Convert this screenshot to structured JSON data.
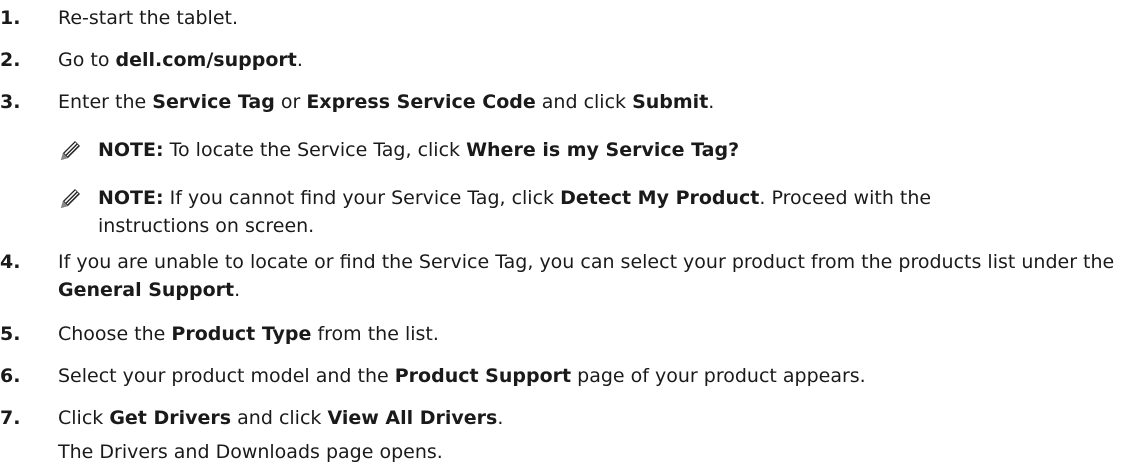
{
  "steps": [
    {
      "num": "1.",
      "parts": [
        "Re-start the tablet."
      ]
    },
    {
      "num": "2.",
      "pre": "Go to ",
      "b1": "dell.com/support",
      "post": "."
    },
    {
      "num": "3.",
      "pre": "Enter the ",
      "b1": "Service Tag",
      "mid1": " or ",
      "b2": "Express Service Code",
      "mid2": " and click ",
      "b3": "Submit",
      "post": "."
    },
    {
      "num": "4.",
      "pre": "If you are unable to locate or find the Service Tag, you can select your product from the products list under the ",
      "b1": "General Support",
      "post": "."
    },
    {
      "num": "5.",
      "pre": "Choose the ",
      "b1": "Product Type",
      "post": " from the list."
    },
    {
      "num": "6.",
      "pre": "Select your product model and the ",
      "b1": "Product Support",
      "post": " page of your product appears."
    },
    {
      "num": "7.",
      "pre": "Click ",
      "b1": "Get Drivers",
      "mid1": " and click ",
      "b2": "View All Drivers",
      "post": "."
    }
  ],
  "notes": [
    {
      "label": "NOTE:",
      "pre": " To locate the Service Tag, click ",
      "b1": "Where is my Service Tag?",
      "post": ""
    },
    {
      "label": "NOTE:",
      "pre": " If you cannot find your Service Tag, click ",
      "b1": "Detect My Product",
      "post": ". Proceed with the instructions on screen."
    }
  ],
  "step7_result": "The Drivers and Downloads page opens.",
  "icons": {
    "note": "note-pencil-icon"
  }
}
